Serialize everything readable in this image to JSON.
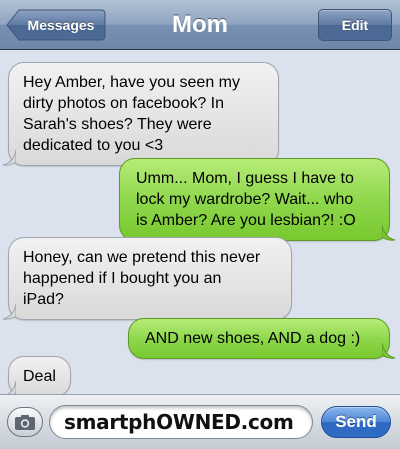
{
  "navbar": {
    "back_label": "Messages",
    "title": "Mom",
    "edit_label": "Edit"
  },
  "messages": [
    {
      "from": "received",
      "text": "Hey Amber, have you seen my\ndirty photos on facebook? In\nSarah's shoes? They were\ndedicated to you <3"
    },
    {
      "from": "sent",
      "text": "Umm... Mom, I guess I have to\nlock my wardrobe? Wait... who\nis Amber? Are you lesbian?! :O"
    },
    {
      "from": "received",
      "text": "Honey, can we pretend this never\nhappened if I bought you an\niPad?"
    },
    {
      "from": "sent",
      "text": "AND new shoes, AND a dog :)"
    },
    {
      "from": "received",
      "text": "Deal"
    }
  ],
  "toolbar": {
    "camera_icon": "camera-icon",
    "input_value": "smartphOWNED.com",
    "send_label": "Send"
  },
  "colors": {
    "sent_bubble": "#8fd84d",
    "received_bubble": "#e4e4e4",
    "background": "#dbe2ed",
    "send_button": "#2f6ac2"
  }
}
